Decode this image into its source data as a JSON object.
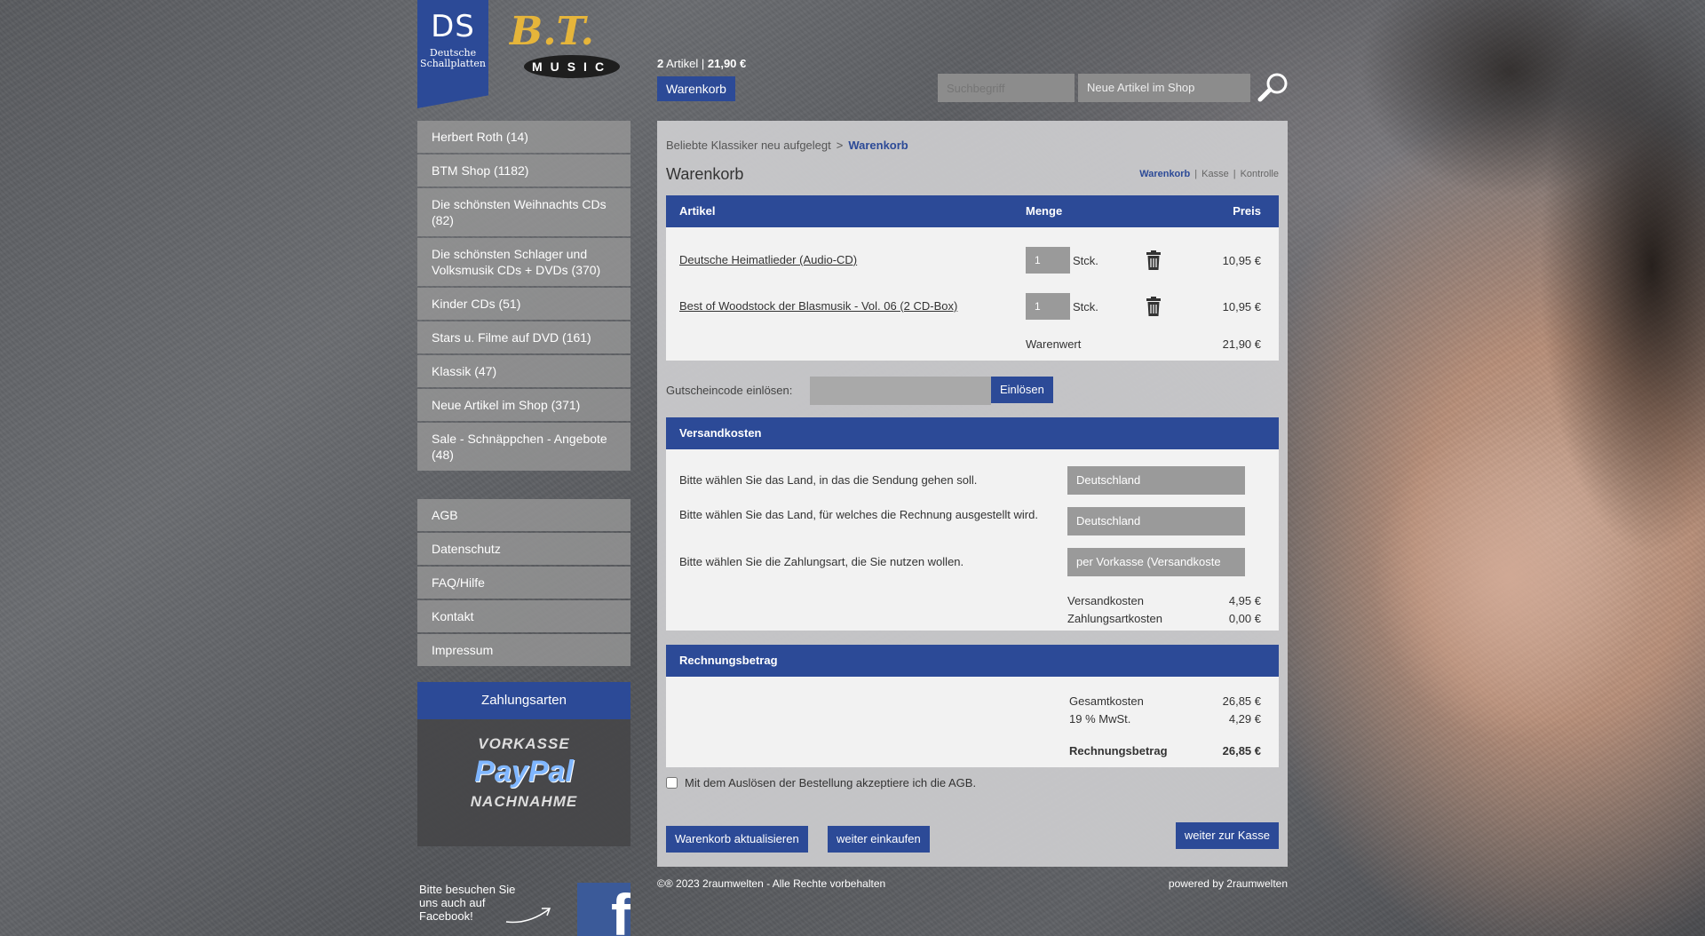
{
  "header": {
    "logo_ds": "DS",
    "logo_ds_sub1": "Deutsche",
    "logo_ds_sub2": "Schallplatten",
    "logo_bt_script": "B.T.",
    "logo_bt_music": "MUSIC",
    "cart_count": "2",
    "cart_count_label": "Artikel",
    "cart_total": "21,90 €",
    "cart_button": "Warenkorb",
    "search_placeholder": "Suchbegriff",
    "search_category": "Neue Artikel im Shop"
  },
  "sidebar": {
    "categories": [
      "Herbert Roth (14)",
      "BTM Shop (1182)",
      "Die schönsten Weihnachts CDs (82)",
      "Die schönsten Schlager und Volksmusik CDs + DVDs (370)",
      "Kinder CDs (51)",
      "Stars u. Filme auf DVD (161)",
      "Klassik (47)",
      "Neue Artikel im Shop (371)",
      "Sale - Schnäppchen - Angebote (48)"
    ],
    "info_links": [
      "AGB",
      "Datenschutz",
      "FAQ/Hilfe",
      "Kontakt",
      "Impressum"
    ],
    "payment": {
      "title": "Zahlungsarten",
      "methods": [
        "VORKASSE",
        "Pay",
        "Pal",
        "NACHNAHME"
      ]
    },
    "facebook_text": "Bitte besuchen Sie uns auch auf Facebook!",
    "facebook_logo": "f"
  },
  "breadcrumb": {
    "parent": "Beliebte Klassiker neu aufgelegt",
    "separator": ">",
    "current": "Warenkorb"
  },
  "page_title": "Warenkorb",
  "steps": [
    "Warenkorb",
    "Kasse",
    "Kontrolle"
  ],
  "cart": {
    "headers": {
      "artikel": "Artikel",
      "menge": "Menge",
      "preis": "Preis"
    },
    "items": [
      {
        "name": "Deutsche Heimatlieder (Audio-CD)",
        "qty": "1",
        "unit": "Stck.",
        "price": "10,95 €"
      },
      {
        "name": "Best of Woodstock der Blasmusik - Vol. 06 (2 CD-Box)",
        "qty": "1",
        "unit": "Stck.",
        "price": "10,95 €"
      }
    ],
    "warenwert_label": "Warenwert",
    "warenwert": "21,90 €"
  },
  "coupon": {
    "label": "Gutscheincode einlösen:",
    "button": "Einlösen"
  },
  "shipping": {
    "title": "Versandkosten",
    "country_label": "Bitte wählen Sie das Land, in das die Sendung gehen soll.",
    "country_value": "Deutschland",
    "invoice_country_label": "Bitte wählen Sie das Land, für welches die Rechnung ausgestellt wird.",
    "invoice_country_value": "Deutschland",
    "payment_label": "Bitte wählen Sie die Zahlungsart, die Sie nutzen wollen.",
    "payment_value": "per Vorkasse (Versandkoste",
    "versandkosten_label": "Versandkosten",
    "versandkosten": "4,95 €",
    "zahlungsart_label": "Zahlungsartkosten",
    "zahlungsart": "0,00 €"
  },
  "invoice": {
    "title": "Rechnungsbetrag",
    "gesamt_label": "Gesamtkosten",
    "gesamt": "26,85 €",
    "mwst_label": "19 % MwSt.",
    "mwst": "4,29 €",
    "total_label": "Rechnungsbetrag",
    "total": "26,85 €"
  },
  "agb_text": "Mit dem Auslösen der Bestellung akzeptiere ich die AGB.",
  "buttons": {
    "update": "Warenkorb aktualisieren",
    "continue": "weiter einkaufen",
    "checkout": "weiter zur Kasse"
  },
  "footer": {
    "copyright": "©® 2023 2raumwelten - Alle Rechte vorbehalten",
    "powered": "powered by 2raumwelten"
  },
  "colors": {
    "accent": "#2c4a97"
  }
}
